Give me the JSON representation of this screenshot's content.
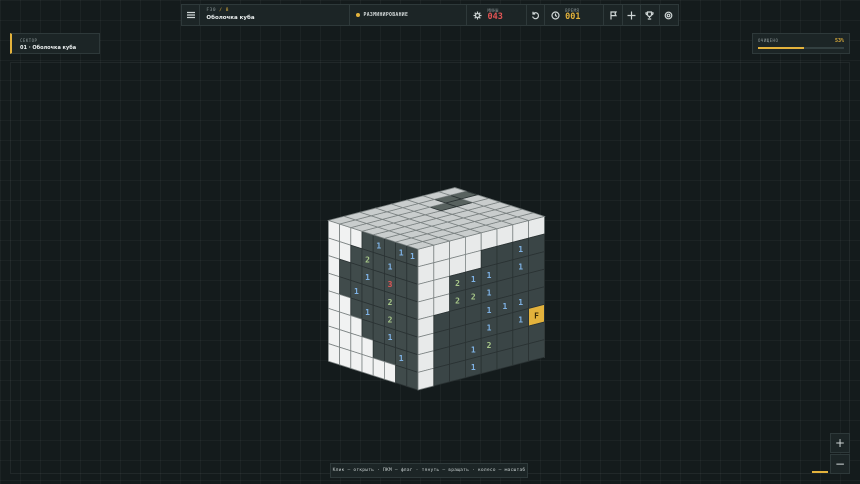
{
  "header": {
    "breadcrumb_prefix": "F30",
    "breadcrumb_sep": "/",
    "breadcrumb_suffix": "8",
    "title": "Оболочка куба",
    "status": "РАЗМИНИРОВАНИЕ",
    "mines_label": "МИНЫ",
    "mines_value": "043",
    "time_label": "ВРЕМЯ",
    "time_value": "001"
  },
  "icons": {
    "menu": "menu-icon",
    "mines": "mine-icon",
    "restart": "restart-icon",
    "clock": "clock-icon",
    "flag": "flag-icon",
    "center": "crosshair-icon",
    "trophy": "trophy-icon",
    "settings": "gear-icon"
  },
  "sector": {
    "label": "СЕКТОР",
    "value": "01 · Оболочка куба"
  },
  "cleared": {
    "label": "ОЧИЩЕНО",
    "value": "53%",
    "fraction": 0.53
  },
  "zoom": {
    "in": "+",
    "out": "−"
  },
  "hint": "Клик — открыть · ПКМ — флаг · тянуть — вращать · колесо — масштаб",
  "colors": {
    "accent": "#e3b23c",
    "danger": "#e05454",
    "number": "#7fb3e6",
    "open_cell": "#3a4546",
    "closed_cell": "#e8eaea"
  },
  "cube": {
    "size": 8,
    "front_face": [
      "########",
      "####..1.",
      "##211.1.",
      "##221...",
      "#...111.",
      "#...1.1F",
      "#..12...",
      "#..1...."
    ],
    "right_face": [
      "...1####",
      "..11####",
      "..1.11##",
      "1..1..1#",
      ".1...1.#",
      "..1#..##",
      "####.###",
      "########"
    ],
    "left_face": [
      "###.1.11",
      "##.2.1..",
      "#..1.3..",
      "#.1..2..",
      "##.1.2..",
      "###..1..",
      "####..1.",
      "######.."
    ],
    "top_face": [
      "########",
      "########",
      "########",
      "########",
      "########",
      "#####..#",
      "######..",
      "########"
    ]
  }
}
